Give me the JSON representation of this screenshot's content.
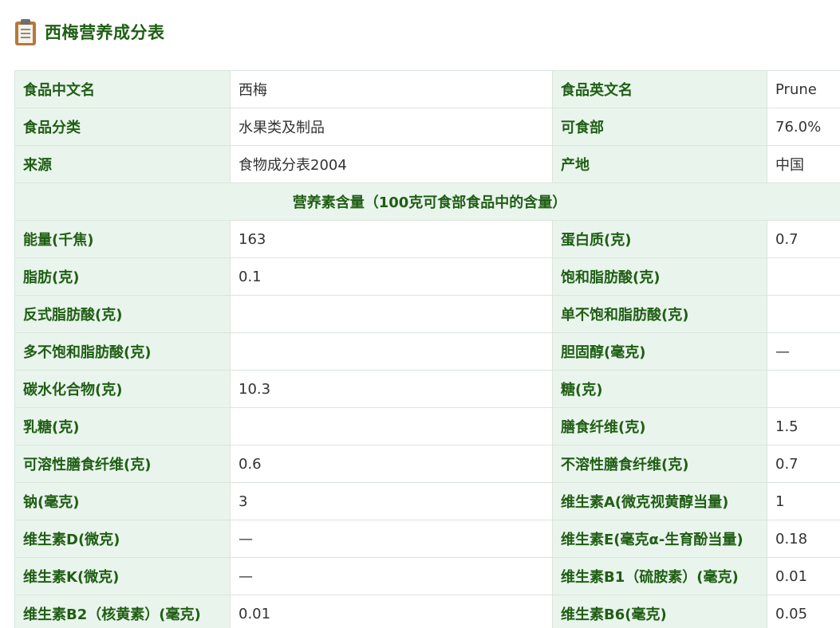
{
  "header": {
    "title": "西梅营养成分表",
    "icon": "clipboard-icon"
  },
  "basic_info": [
    {
      "label1": "食品中文名",
      "value1": "西梅",
      "label2": "食品英文名",
      "value2": "Prune"
    },
    {
      "label1": "食品分类",
      "value1": "水果类及制品",
      "label2": "可食部",
      "value2": "76.0%"
    },
    {
      "label1": "来源",
      "value1": "食物成分表2004",
      "label2": "产地",
      "value2": "中国"
    }
  ],
  "section_title": "营养素含量（100克可食部食品中的含量）",
  "nutrients": [
    {
      "label1": "能量(千焦)",
      "value1": "163",
      "label2": "蛋白质(克)",
      "value2": "0.7"
    },
    {
      "label1": "脂肪(克)",
      "value1": "0.1",
      "label2": "饱和脂肪酸(克)",
      "value2": ""
    },
    {
      "label1": "反式脂肪酸(克)",
      "value1": "",
      "label2": "单不饱和脂肪酸(克)",
      "value2": ""
    },
    {
      "label1": "多不饱和脂肪酸(克)",
      "value1": "",
      "label2": "胆固醇(毫克)",
      "value2": "—"
    },
    {
      "label1": "碳水化合物(克)",
      "value1": "10.3",
      "label2": "糖(克)",
      "value2": ""
    },
    {
      "label1": "乳糖(克)",
      "value1": "",
      "label2": "膳食纤维(克)",
      "value2": "1.5"
    },
    {
      "label1": "可溶性膳食纤维(克)",
      "value1": "0.6",
      "label2": "不溶性膳食纤维(克)",
      "value2": "0.7"
    },
    {
      "label1": "钠(毫克)",
      "value1": "3",
      "label2": "维生素A(微克视黄醇当量)",
      "value2": "1"
    },
    {
      "label1": "维生素D(微克)",
      "value1": "—",
      "label2": "维生素E(毫克α-生育酚当量)",
      "value2": "0.18"
    },
    {
      "label1": "维生素K(微克)",
      "value1": "—",
      "label2": "维生素B1（硫胺素）(毫克)",
      "value2": "0.01"
    },
    {
      "label1": "维生素B2（核黄素）(毫克)",
      "value1": "0.01",
      "label2": "维生素B6(毫克)",
      "value2": "0.05"
    }
  ],
  "colors": {
    "label_bg": "#e9f4ec",
    "label_text": "#1f5e14",
    "border": "#dbe5dc",
    "value_text": "#333333"
  }
}
